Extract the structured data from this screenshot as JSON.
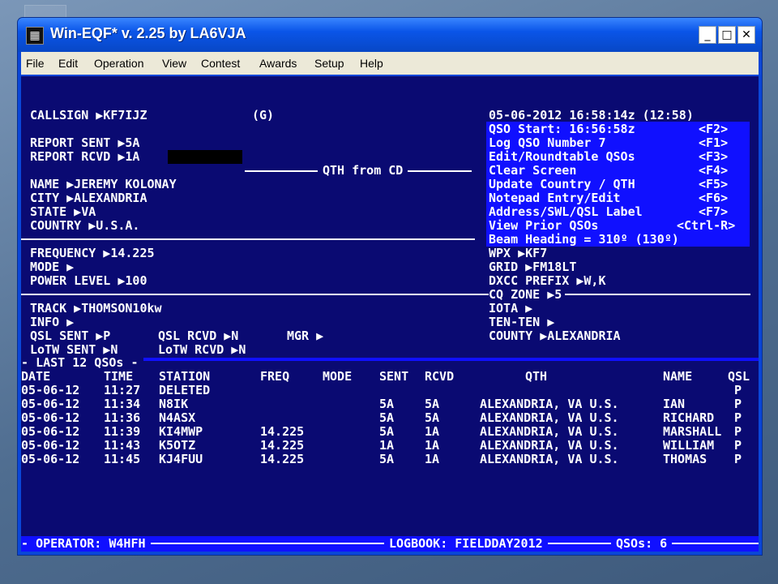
{
  "window": {
    "title": "Win-EQF* v. 2.25 by LA6VJA",
    "icon": "radio-app-icon",
    "controls": {
      "minimize": "_",
      "maximize": "□",
      "close": "✕"
    }
  },
  "menu": [
    "File",
    "Edit",
    "Operation",
    "View",
    "Contest",
    "Awards",
    "Setup",
    "Help"
  ],
  "fields": {
    "callsign": "CALLSIGN ▶KF7IJZ",
    "callsign_suffix": "(G)",
    "report_sent": "REPORT SENT ▶5A",
    "report_rcvd": "REPORT RCVD ▶1A",
    "qth_section": "QTH from CD",
    "name": "NAME ▶JEREMY KOLONAY",
    "city": "CITY ▶ALEXANDRIA",
    "state": "STATE ▶VA",
    "country": "COUNTRY ▶U.S.A.",
    "frequency": "FREQUENCY ▶14.225",
    "mode": "MODE ▶",
    "power": "POWER LEVEL ▶100",
    "track": "TRACK ▶THOMSON10kw",
    "info": "INFO ▶",
    "qsl_sent": "QSL SENT ▶P",
    "qsl_rcvd": "QSL RCVD ▶N",
    "mgr": "MGR ▶",
    "lotw_sent": "LoTW SENT ▶N",
    "lotw_rcvd": "LoTW RCVD ▶N"
  },
  "right_panel": {
    "datetime": "05-06-2012 16:58:14z (12:58)",
    "fkeys": [
      {
        "label": "QSO Start: 16:56:58z",
        "key": "<F2>"
      },
      {
        "label": "Log QSO Number 7",
        "key": "<F1>"
      },
      {
        "label": "Edit/Roundtable QSOs",
        "key": "<F3>"
      },
      {
        "label": "Clear Screen",
        "key": "<F4>"
      },
      {
        "label": "Update Country / QTH",
        "key": "<F5>"
      },
      {
        "label": "Notepad Entry/Edit",
        "key": "<F6>"
      },
      {
        "label": "Address/SWL/QSL Label",
        "key": "<F7>"
      },
      {
        "label": "View Prior QSOs",
        "key": "<Ctrl-R>"
      },
      {
        "label": "Beam Heading = 310º (130º)",
        "key": ""
      }
    ],
    "wpx": "WPX ▶KF7",
    "grid": "GRID ▶FM18LT",
    "dxcc": "DXCC PREFIX ▶W,K",
    "cq_zone": "CQ ZONE ▶5",
    "iota": "IOTA ▶",
    "ten_ten": "TEN-TEN ▶",
    "county": "COUNTY ▶ALEXANDRIA"
  },
  "log": {
    "section_title": "LAST 12 QSOs",
    "columns": [
      "DATE",
      "TIME",
      "STATION",
      "FREQ",
      "MODE",
      "SENT",
      "RCVD",
      "QTH",
      "NAME",
      "QSL"
    ],
    "rows": [
      [
        "05-06-12",
        "11:27",
        "DELETED",
        "",
        "",
        "",
        "",
        "",
        "",
        "P"
      ],
      [
        "05-06-12",
        "11:34",
        "N8IK",
        "",
        "",
        "5A",
        "5A",
        "ALEXANDRIA, VA U.S.",
        "IAN",
        "P"
      ],
      [
        "05-06-12",
        "11:36",
        "N4ASX",
        "",
        "",
        "5A",
        "5A",
        "ALEXANDRIA, VA U.S.",
        "RICHARD",
        "P"
      ],
      [
        "05-06-12",
        "11:39",
        "KI4MWP",
        "14.225",
        "",
        "5A",
        "1A",
        "ALEXANDRIA, VA U.S.",
        "MARSHALL",
        "P"
      ],
      [
        "05-06-12",
        "11:43",
        "K5OTZ",
        "14.225",
        "",
        "1A",
        "1A",
        "ALEXANDRIA, VA U.S.",
        "WILLIAM",
        "P"
      ],
      [
        "05-06-12",
        "11:45",
        "KJ4FUU",
        "14.225",
        "",
        "5A",
        "1A",
        "ALEXANDRIA, VA U.S.",
        "THOMAS",
        "P"
      ]
    ]
  },
  "status": {
    "operator": "OPERATOR: W4HFH",
    "logbook": "LOGBOOK: FIELDDAY2012",
    "qsos": "QSOs: 6"
  },
  "colors": {
    "console_bg": "#0a0a72",
    "highlight_blue": "#1010ff",
    "text": "#ffffff"
  }
}
